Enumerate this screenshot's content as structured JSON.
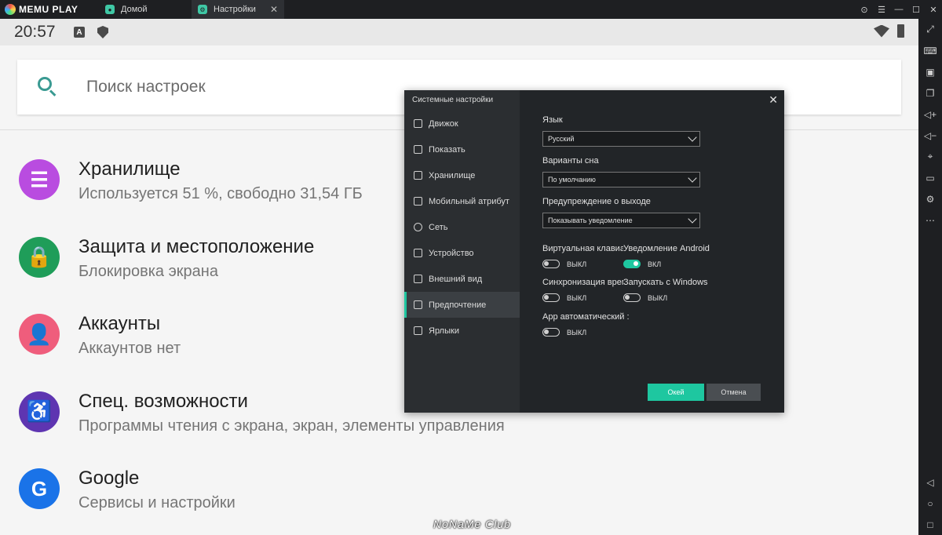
{
  "app": {
    "logo_text": "MEMU PLAY",
    "tabs": [
      {
        "label": "Домой"
      },
      {
        "label": "Настройки",
        "close": "✕"
      }
    ],
    "window_controls": [
      "⊙",
      "☰",
      "—",
      "☐",
      "✕"
    ]
  },
  "status_bar": {
    "time": "20:57",
    "a_icon": "A"
  },
  "search": {
    "placeholder": "Поиск настроек"
  },
  "settings": [
    {
      "title": "Хранилище",
      "subtitle": "Используется 51 %, свободно 31,54 ГБ",
      "color": "#b94ce0",
      "icon": "storage-icon",
      "glyph": "☰"
    },
    {
      "title": "Защита и местоположение",
      "subtitle": "Блокировка экрана",
      "color": "#1f9d59",
      "icon": "lock-icon",
      "glyph": "🔒"
    },
    {
      "title": "Аккаунты",
      "subtitle": "Аккаунтов нет",
      "color": "#ef5d7c",
      "icon": "account-icon",
      "glyph": "👤"
    },
    {
      "title": "Спец. возможности",
      "subtitle": "Программы чтения с экрана, экран, элементы управления",
      "color": "#5e35b1",
      "icon": "accessibility-icon",
      "glyph": "♿"
    },
    {
      "title": "Google",
      "subtitle": "Сервисы и настройки",
      "color": "#1a73e8",
      "icon": "google-icon",
      "glyph": "G"
    }
  ],
  "watermark": "NoNaMe Club",
  "modal": {
    "title": "Системные настройки",
    "close": "✕",
    "nav": [
      {
        "label": "Движок",
        "active": false
      },
      {
        "label": "Показать",
        "active": false
      },
      {
        "label": "Хранилище",
        "active": false
      },
      {
        "label": "Мобильный атрибут",
        "active": false
      },
      {
        "label": "Сеть",
        "active": false
      },
      {
        "label": "Устройство",
        "active": false
      },
      {
        "label": "Внешний вид",
        "active": false
      },
      {
        "label": "Предпочтение",
        "active": true
      },
      {
        "label": "Ярлыки",
        "active": false
      }
    ],
    "language_label": "Язык",
    "language_value": "Русский",
    "sleep_label": "Варианты сна",
    "sleep_value": "По умолчанию",
    "exit_label": "Предупреждение о выходе",
    "exit_value": "Показывать уведомление",
    "virtual_kbd_label": "Виртуальная клавиат",
    "virtual_kbd_state": "ВЫКЛ",
    "android_notif_label": "Уведомление Android",
    "android_notif_state": "ВКЛ",
    "time_sync_label": "Синхронизация врем",
    "time_sync_state": "ВЫКЛ",
    "start_windows_label": "Запускать с Windows",
    "start_windows_state": "ВЫКЛ",
    "app_auto_label": "App автоматический :",
    "app_auto_state": "ВЫКЛ",
    "ok_label": "Окей",
    "cancel_label": "Отмена"
  },
  "colors": {
    "accent": "#1ec7a0",
    "modal_bg": "#222528",
    "titlebar_bg": "#1e1f22"
  }
}
